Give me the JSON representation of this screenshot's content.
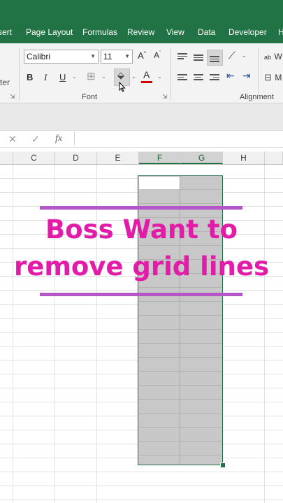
{
  "menu": {
    "tabs": [
      "sert",
      "Page Layout",
      "Formulas",
      "Review",
      "View",
      "Data",
      "Developer",
      "H"
    ]
  },
  "ribbon": {
    "clipboard_label": "ter",
    "font_name": "Calibri",
    "font_size": "11",
    "grow_font": "A",
    "shrink_font": "A",
    "bold": "B",
    "italic": "I",
    "underline": "U",
    "font_color_letter": "A",
    "font_group_label": "Font",
    "alignment_group_label": "Alignment",
    "wrap_text_icon_text": "ab",
    "wrap_text_label": "W",
    "merge_label": "M"
  },
  "formula_bar": {
    "cancel": "✕",
    "enter": "✓",
    "function": "fx",
    "value": ""
  },
  "columns": [
    "C",
    "D",
    "E",
    "F",
    "G",
    "H"
  ],
  "overlay": {
    "line1": "Boss Want to",
    "line2": "remove grid lines"
  },
  "colors": {
    "excel_green": "#217346",
    "overlay_text": "#e21ba8",
    "overlay_rule": "#b455c8",
    "font_color_bar": "#d00000"
  }
}
